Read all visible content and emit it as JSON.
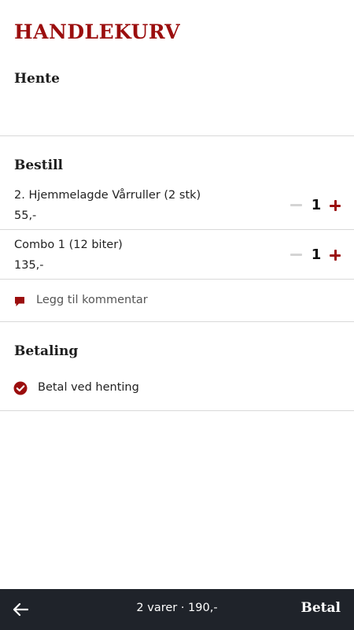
{
  "header": {
    "title": "HANDLEKURV"
  },
  "pickup": {
    "title": "Hente"
  },
  "order": {
    "title": "Bestill",
    "items": [
      {
        "name": "2. Hjemmelagde Vårruller (2 stk)",
        "price": "55,-",
        "quantity": "1"
      },
      {
        "name": "Combo 1 (12 biter)",
        "price": "135,-",
        "quantity": "1"
      }
    ],
    "comment_label": "Legg til kommentar",
    "comment_icon": "speech-bubble-icon"
  },
  "payment": {
    "title": "Betaling",
    "selected_option": "Betal ved henting",
    "option_icon": "check-circle-icon"
  },
  "bottom_bar": {
    "summary": "2 varer · 190,-",
    "pay_label": "Betal",
    "back_icon": "arrow-left-icon"
  },
  "colors": {
    "accent": "#9b0e0e",
    "bottom_bar": "#1f232a",
    "divider": "#d9d9d9",
    "disabled_minus": "#d4d4d4"
  }
}
